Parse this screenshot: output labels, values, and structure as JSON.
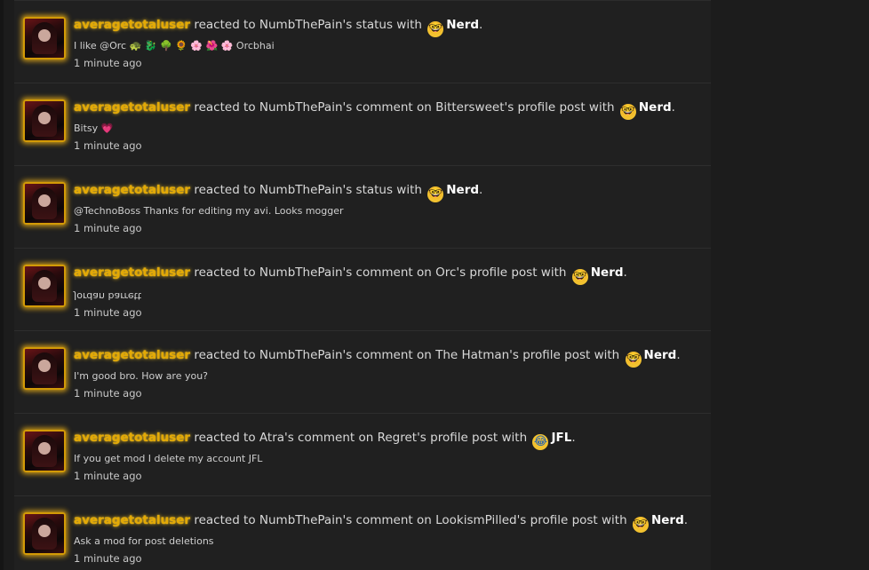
{
  "feed": {
    "items": [
      {
        "user": "averagetotaluser",
        "middle": "reacted to NumbThePain's status with",
        "reaction": "Nerd",
        "reaction_icon": "nerd-face-icon",
        "end": ".",
        "snippet": "I like @Orc 🐢 🐉 🌳 🌻 🌸 🌺 🌸 Orcbhai",
        "time": "1 minute ago"
      },
      {
        "user": "averagetotaluser",
        "middle": "reacted to NumbThePain's comment on Bittersweet's profile post with",
        "reaction": "Nerd",
        "reaction_icon": "nerd-face-icon",
        "end": ".",
        "snippet": "Bitsy 💗",
        "time": "1 minute ago"
      },
      {
        "user": "averagetotaluser",
        "middle": "reacted to NumbThePain's status with",
        "reaction": "Nerd",
        "reaction_icon": "nerd-face-icon",
        "end": ".",
        "snippet": "@TechnoBoss Thanks for editing my avi. Looks mogger",
        "time": "1 minute ago"
      },
      {
        "user": "averagetotaluser",
        "middle": "reacted to NumbThePain's comment on Orc's profile post with",
        "reaction": "Nerd",
        "reaction_icon": "nerd-face-icon",
        "end": ".",
        "snippet": "Jordan barrett",
        "time": "1 minute ago"
      },
      {
        "user": "averagetotaluser",
        "middle": "reacted to NumbThePain's comment on The Hatman's profile post with",
        "reaction": "Nerd",
        "reaction_icon": "nerd-face-icon",
        "end": ".",
        "snippet": "I'm good bro. How are you?",
        "time": "1 minute ago"
      },
      {
        "user": "averagetotaluser",
        "middle": "reacted to Atra's comment on Regret's profile post with",
        "reaction": "JFL",
        "reaction_icon": "laughing-crying-face-icon",
        "end": ".",
        "snippet": "If you get mod I delete my account JFL",
        "time": "1 minute ago"
      },
      {
        "user": "averagetotaluser",
        "middle": "reacted to NumbThePain's comment on LookismPilled's profile post with",
        "reaction": "Nerd",
        "reaction_icon": "nerd-face-icon",
        "end": ".",
        "snippet": "Ask a mod for post deletions",
        "time": "1 minute ago"
      }
    ]
  },
  "colors": {
    "background": "#1c1c1c",
    "feed_background": "#202020",
    "username": "#e3a905",
    "avatar_glow": "#ffbe14",
    "reaction_text": "#ffffff",
    "body_text": "#d8d8d8"
  }
}
